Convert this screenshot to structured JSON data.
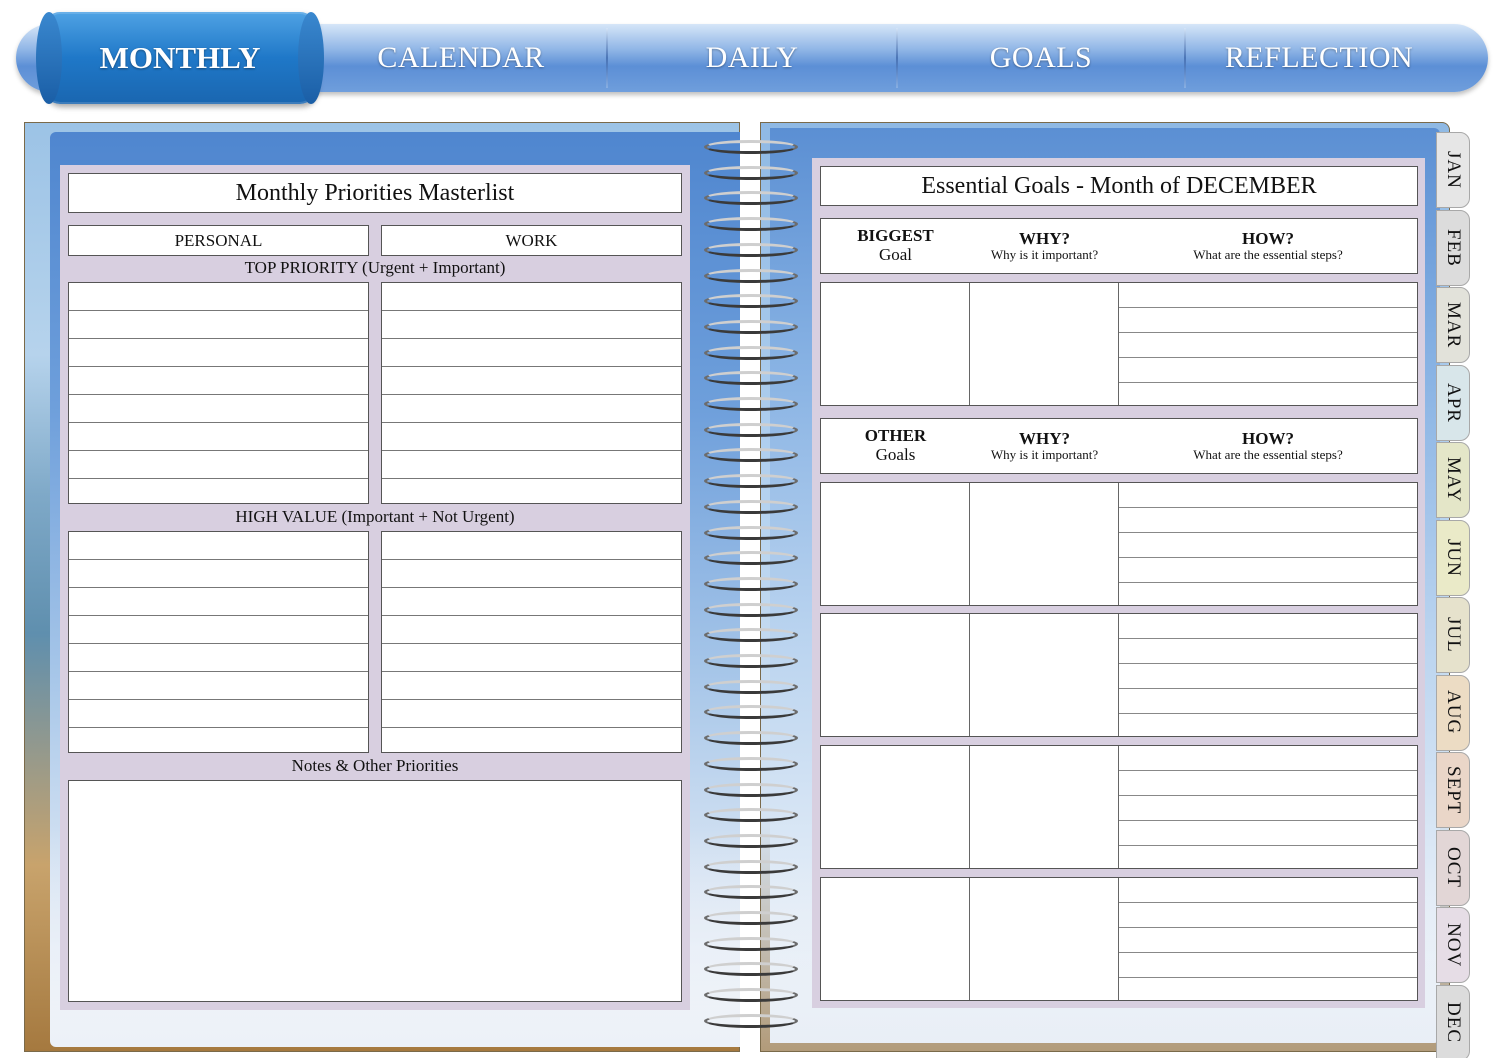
{
  "nav": {
    "tabs": [
      {
        "label": "MONTHLY",
        "active": true
      },
      {
        "label": "CALENDAR",
        "active": false
      },
      {
        "label": "DAILY",
        "active": false
      },
      {
        "label": "GOALS",
        "active": false
      },
      {
        "label": "REFLECTION",
        "active": false
      }
    ]
  },
  "left_page": {
    "title": "Monthly Priorities Masterlist",
    "col_personal": "PERSONAL",
    "col_work": "WORK",
    "section_top": "TOP PRIORITY (Urgent + Important)",
    "section_high": "HIGH VALUE (Important + Not Urgent)",
    "section_notes": "Notes & Other Priorities"
  },
  "right_page": {
    "title": "Essential Goals - Month of DECEMBER",
    "biggest": {
      "main": "BIGGEST",
      "sub": "Goal"
    },
    "other": {
      "main": "OTHER",
      "sub": "Goals"
    },
    "why": {
      "main": "WHY?",
      "sub": "Why is it important?"
    },
    "how": {
      "main": "HOW?",
      "sub": "What are the essential steps?"
    }
  },
  "month_tabs": [
    "JAN",
    "FEB",
    "MAR",
    "APR",
    "MAY",
    "JUN",
    "JUL",
    "AUG",
    "SEPT",
    "OCT",
    "NOV",
    "DEC"
  ],
  "colors": {
    "nav_active": "#1f78c8",
    "nav_bar": "#6f9edc",
    "panel_lavender": "#d8cfe0",
    "tab_colors": [
      "#e6e6e6",
      "#dcdcdc",
      "#e2e2da",
      "#d8e6ea",
      "#e4e6c8",
      "#eaeac8",
      "#e6e2cc",
      "#ecdcc4",
      "#ead6c8",
      "#e2d6d6",
      "#e6dde6",
      "#dcdcdc"
    ]
  }
}
